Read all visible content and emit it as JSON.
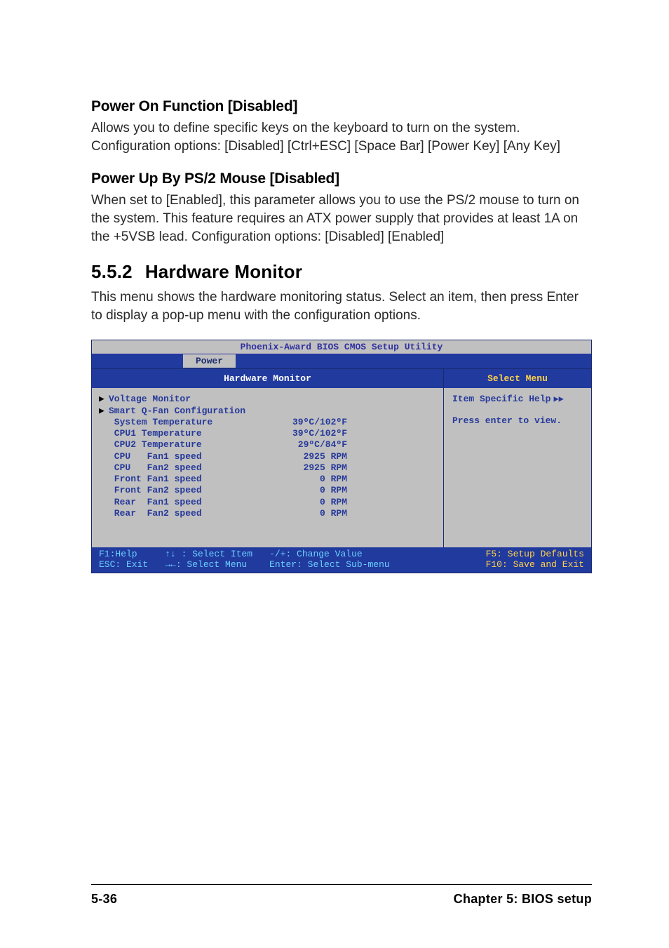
{
  "sections": {
    "s1": {
      "title": "Power On Function [Disabled]",
      "body": "Allows you to define specific keys on the keyboard to turn on the system. Configuration options: [Disabled] [Ctrl+ESC] [Space Bar] [Power Key] [Any Key]"
    },
    "s2": {
      "title": "Power Up By PS/2 Mouse [Disabled]",
      "body": "When set to [Enabled], this parameter allows you to use the PS/2 mouse to turn on the system. This feature requires an ATX power supply that provides at least 1A on the +5VSB lead. Configuration options: [Disabled] [Enabled]"
    },
    "s3": {
      "number": "5.5.2",
      "title": "Hardware Monitor",
      "body": "This menu shows the hardware monitoring status. Select an item, then press Enter to display a pop-up menu with the configuration options."
    }
  },
  "bios": {
    "titlebar": "Phoenix-Award BIOS CMOS Setup Utility",
    "tab": "Power",
    "subheader_left": "Hardware Monitor",
    "subheader_right": "Select Menu",
    "items": {
      "voltage_monitor": {
        "arrow": "▶",
        "label": "Voltage Monitor",
        "value": ""
      },
      "smart_qfan": {
        "arrow": "▶",
        "label": "Smart Q-Fan Configuration",
        "value": ""
      },
      "sys_temp": {
        "arrow": "",
        "label": " System Temperature",
        "value": "39ºC/102ºF"
      },
      "cpu1_temp": {
        "arrow": "",
        "label": " CPU1 Temperature",
        "value": "39ºC/102ºF"
      },
      "cpu2_temp": {
        "arrow": "",
        "label": " CPU2 Temperature",
        "value": "29ºC/84ºF"
      },
      "cpu_fan1": {
        "arrow": "",
        "label": " CPU   Fan1 speed",
        "value": "2925 RPM"
      },
      "cpu_fan2": {
        "arrow": "",
        "label": " CPU   Fan2 speed",
        "value": "2925 RPM"
      },
      "front_fan1": {
        "arrow": "",
        "label": " Front Fan1 speed",
        "value": "0 RPM"
      },
      "front_fan2": {
        "arrow": "",
        "label": " Front Fan2 speed",
        "value": "0 RPM"
      },
      "rear_fan1": {
        "arrow": "",
        "label": " Rear  Fan1 speed",
        "value": "0 RPM"
      },
      "rear_fan2": {
        "arrow": "",
        "label": " Rear  Fan2 speed",
        "value": "0 RPM"
      }
    },
    "help_title": "Item Specific Help",
    "help_body": "Press enter to view.",
    "footer": {
      "c1a": "F1:Help",
      "c1b": "ESC: Exit",
      "c2a": "↑↓ : Select Item",
      "c2b": "→←: Select Menu",
      "c3a": "-/+: Change Value",
      "c3b": "Enter: Select Sub-menu",
      "c4a": "F5: Setup Defaults",
      "c4b": "F10: Save and Exit"
    }
  },
  "footer": {
    "left": "5-36",
    "right": "Chapter 5: BIOS setup"
  }
}
